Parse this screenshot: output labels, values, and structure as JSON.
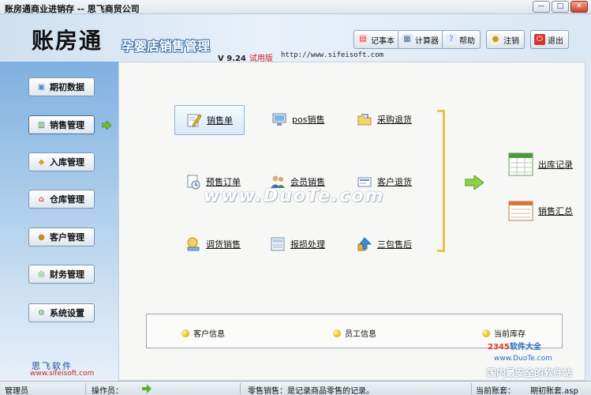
{
  "window": {
    "title": "账房通商业进销存 -- 思飞商贸公司",
    "controls": {
      "minimize": "—",
      "maximize": "□",
      "close": "✕"
    }
  },
  "header": {
    "brand": "账房通",
    "subtitle": "孕婴店销售管理",
    "version": "V 9.24",
    "trial": "试用版",
    "url": "http://www.sifeisoft.com",
    "toolbar": [
      {
        "label": "记事本",
        "icon": "notepad-icon",
        "color": "#d9342b"
      },
      {
        "label": "计算器",
        "icon": "calculator-icon",
        "color": "#4a6f99"
      },
      {
        "label": "帮助",
        "icon": "help-icon",
        "color": "#3c7bc8"
      },
      {
        "label": "注销",
        "icon": "logout-user-icon",
        "color": "#c89a2a"
      },
      {
        "label": "退出",
        "icon": "exit-icon",
        "color": "#d9342b"
      }
    ]
  },
  "sidebar": {
    "items": [
      {
        "label": "期初数据",
        "icon": "initial-data-icon",
        "color": "#4c8ed0"
      },
      {
        "label": "销售管理",
        "icon": "sales-icon",
        "color": "#3f8f45",
        "active": true
      },
      {
        "label": "入库管理",
        "icon": "stock-in-icon",
        "color": "#d6a22a"
      },
      {
        "label": "仓库管理",
        "icon": "warehouse-icon",
        "color": "#c95b2e"
      },
      {
        "label": "客户管理",
        "icon": "customer-icon",
        "color": "#c78a2a"
      },
      {
        "label": "财务管理",
        "icon": "finance-icon",
        "color": "#3f9a46"
      },
      {
        "label": "系统设置",
        "icon": "settings-icon",
        "color": "#4d8a4a"
      }
    ],
    "footer_brand": "思飞软件",
    "footer_url": "www.sifeisoft.com"
  },
  "main": {
    "functions": [
      {
        "label": "销售单",
        "icon": "sales-order-icon",
        "active": true
      },
      {
        "label": "pos销售",
        "icon": "pos-terminal-icon"
      },
      {
        "label": "采购退货",
        "icon": "purchase-return-icon"
      },
      {
        "label": "预售订单",
        "icon": "presale-order-icon"
      },
      {
        "label": "会员销售",
        "icon": "member-sales-icon"
      },
      {
        "label": "客户退货",
        "icon": "customer-return-icon"
      },
      {
        "label": "调货销售",
        "icon": "transfer-sales-icon"
      },
      {
        "label": "报损处理",
        "icon": "damage-report-icon"
      },
      {
        "label": "三包售后",
        "icon": "after-sales-icon"
      }
    ],
    "reports": [
      {
        "label": "出库记录",
        "icon": "outbound-records-icon"
      },
      {
        "label": "销售汇总",
        "icon": "sales-summary-icon"
      }
    ],
    "info": [
      {
        "label": "客户信息"
      },
      {
        "label": "员工信息"
      },
      {
        "label": "当前库存"
      }
    ]
  },
  "watermark": {
    "main": "www.DuoTe.com",
    "badge_a": "2345",
    "badge_b": "软件大全",
    "badge_url": "www.DuoTe.com",
    "tagline": "国内最安全的软件站"
  },
  "statusbar": {
    "role": "管理员",
    "operator_label": "操作员：",
    "hint": "零售销售：是记录商品零售的记录。",
    "account_label": "当前账套：",
    "period": "期初账套.asp"
  }
}
